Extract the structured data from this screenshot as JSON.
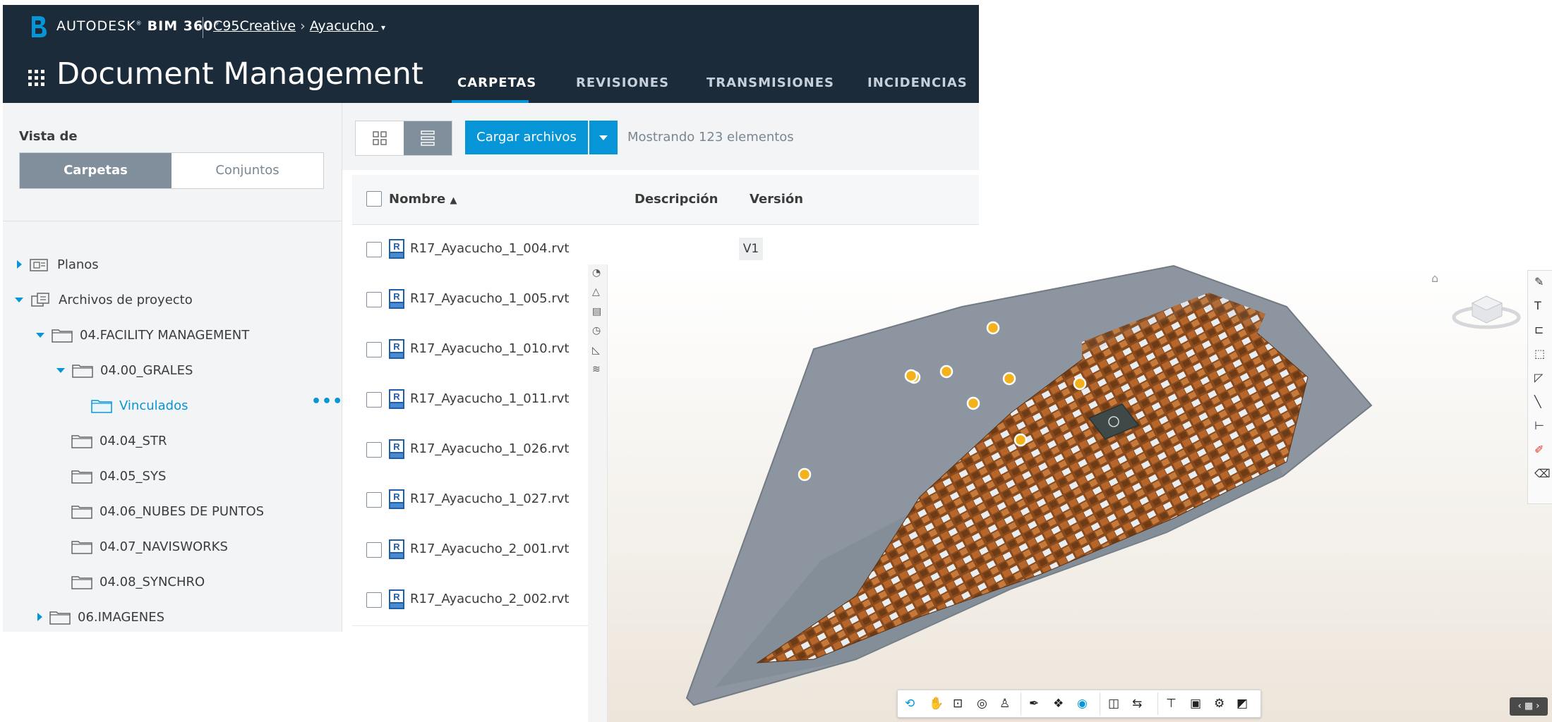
{
  "header": {
    "brand": "AUTODESK",
    "product": "BIM 360",
    "account": "C95Creative",
    "project": "Ayacucho",
    "app_title": "Document Management",
    "tabs": [
      {
        "label": "CARPETAS",
        "active": true
      },
      {
        "label": "REVISIONES",
        "active": false
      },
      {
        "label": "TRANSMISIONES",
        "active": false
      },
      {
        "label": "INCIDENCIAS",
        "active": false
      }
    ]
  },
  "sidebar": {
    "view_label": "Vista de",
    "segments": [
      "Carpetas",
      "Conjuntos"
    ],
    "tree": [
      {
        "label": "Planos",
        "level": 0,
        "state": "collapsed",
        "icon": "plans-icon"
      },
      {
        "label": "Archivos de proyecto",
        "level": 0,
        "state": "expanded",
        "icon": "project-files-icon"
      },
      {
        "label": "04.FACILITY MANAGEMENT",
        "level": 1,
        "state": "expanded",
        "icon": "folder-icon"
      },
      {
        "label": "04.00_GRALES",
        "level": 2,
        "state": "expanded",
        "icon": "folder-icon"
      },
      {
        "label": "Vinculados",
        "level": 3,
        "state": "selected",
        "icon": "folder-icon"
      },
      {
        "label": "04.04_STR",
        "level": 2,
        "state": "leaf",
        "icon": "folder-icon"
      },
      {
        "label": "04.05_SYS",
        "level": 2,
        "state": "leaf",
        "icon": "folder-icon"
      },
      {
        "label": "04.06_NUBES DE PUNTOS",
        "level": 2,
        "state": "leaf",
        "icon": "folder-icon"
      },
      {
        "label": "04.07_NAVISWORKS",
        "level": 2,
        "state": "leaf",
        "icon": "folder-icon"
      },
      {
        "label": "04.08_SYNCHRO",
        "level": 2,
        "state": "leaf",
        "icon": "folder-icon"
      },
      {
        "label": "06.IMAGENES",
        "level": 1,
        "state": "collapsed",
        "icon": "folder-icon"
      }
    ]
  },
  "toolbar": {
    "upload_label": "Cargar archivos",
    "count_text": "Mostrando 123 elementos"
  },
  "table": {
    "columns": [
      "Nombre",
      "Descripción",
      "Versión"
    ],
    "rows": [
      {
        "name": "R17_Ayacucho_1_004.rvt",
        "version": "V1"
      },
      {
        "name": "R17_Ayacucho_1_005.rvt",
        "version": ""
      },
      {
        "name": "R17_Ayacucho_1_010.rvt",
        "version": ""
      },
      {
        "name": "R17_Ayacucho_1_011.rvt",
        "version": ""
      },
      {
        "name": "R17_Ayacucho_1_026.rvt",
        "version": ""
      },
      {
        "name": "R17_Ayacucho_1_027.rvt",
        "version": ""
      },
      {
        "name": "R17_Ayacucho_2_001.rvt",
        "version": ""
      },
      {
        "name": "R17_Ayacucho_2_002.rvt",
        "version": ""
      }
    ]
  },
  "viewer": {
    "markers": 9,
    "colors": {
      "terrain": "#8d96a0",
      "roofs": "#a35a22",
      "marker": "#f3b21b"
    }
  },
  "colors": {
    "header_bg": "#1c2b3a",
    "accent": "#0696d7",
    "panel_bg": "#f3f4f5"
  }
}
